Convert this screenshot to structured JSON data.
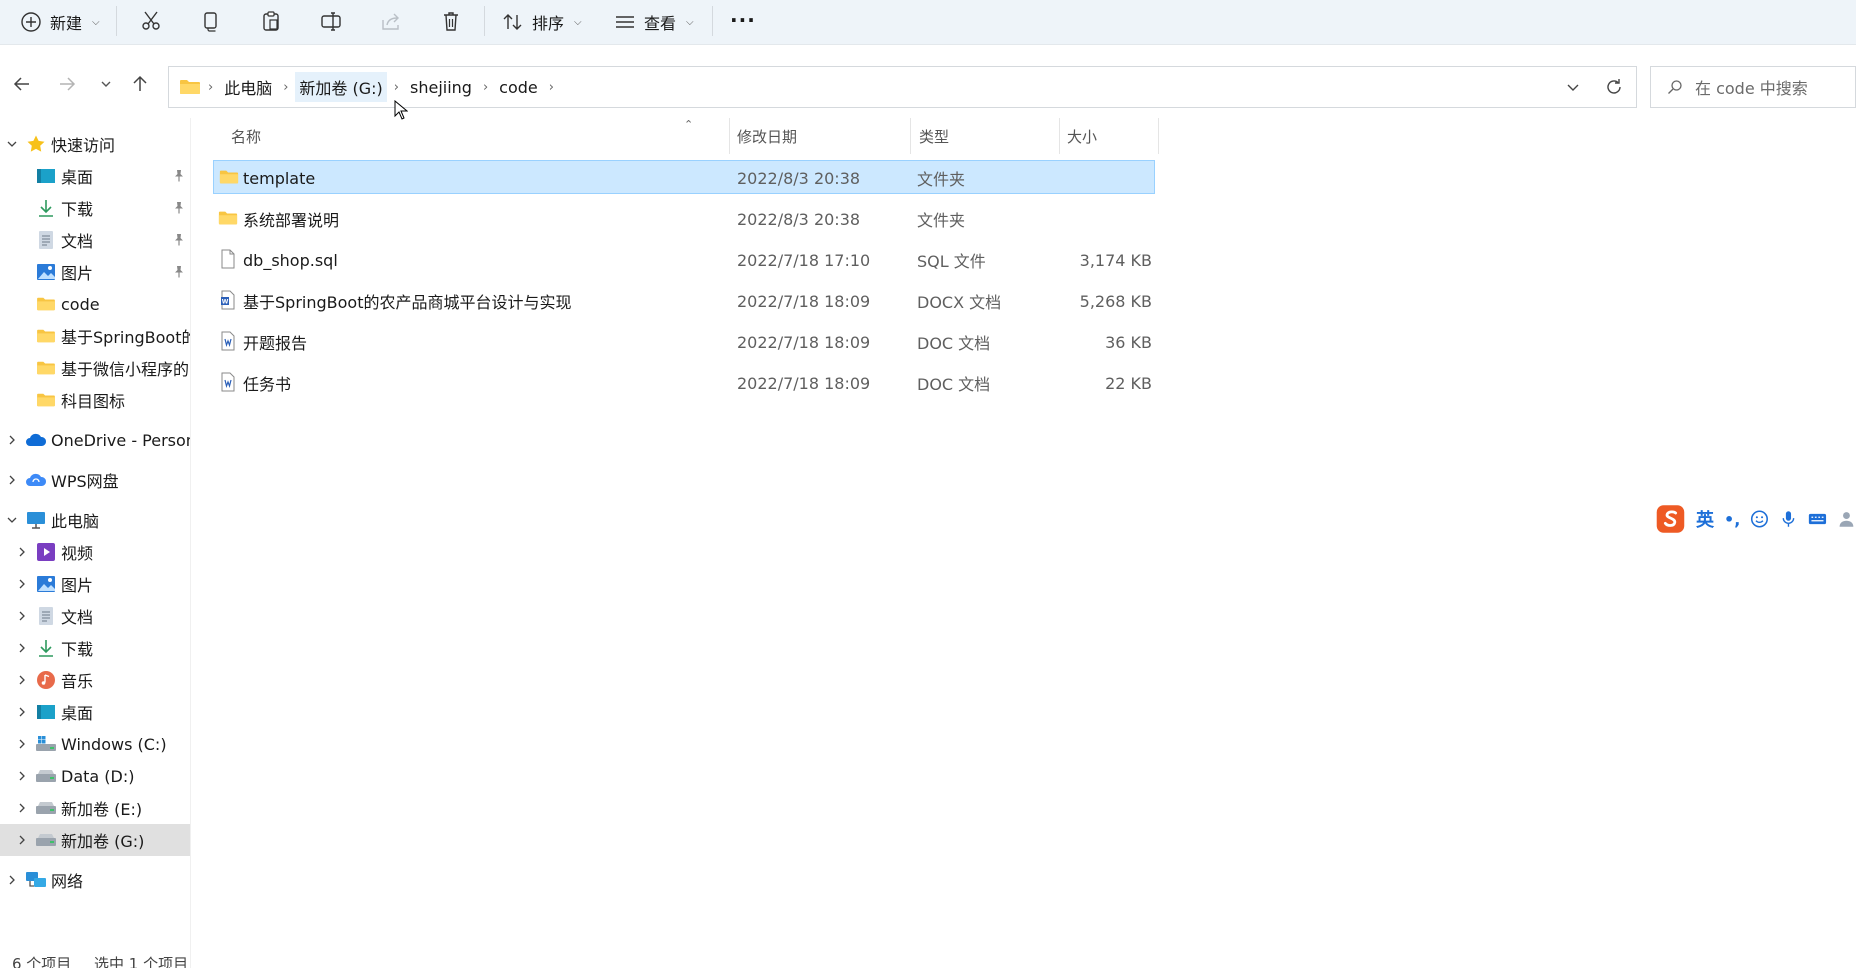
{
  "toolbar": {
    "new_label": "新建",
    "sort_label": "排序",
    "view_label": "查看",
    "more_label": "···"
  },
  "address": {
    "crumbs": [
      "此电脑",
      "新加卷 (G:)",
      "shejiing",
      "code"
    ]
  },
  "search": {
    "placeholder": "在 code 中搜索"
  },
  "sidebar": {
    "quick_access": "快速访问",
    "quick_items": [
      "桌面",
      "下载",
      "文档",
      "图片",
      "code",
      "基于SpringBoot的",
      "基于微信小程序的医",
      "科目图标"
    ],
    "onedrive": "OneDrive - Persona",
    "wps": "WPS网盘",
    "this_pc": "此电脑",
    "pc_items": [
      "视频",
      "图片",
      "文档",
      "下载",
      "音乐",
      "桌面",
      "Windows (C:)",
      "Data (D:)",
      "新加卷 (E:)",
      "新加卷 (G:)"
    ],
    "network": "网络"
  },
  "columns": {
    "name": "名称",
    "modified": "修改日期",
    "type": "类型",
    "size": "大小"
  },
  "files": [
    {
      "name": "template",
      "modified": "2022/8/3 20:38",
      "type": "文件夹",
      "size": "",
      "icon": "folder-icon",
      "selected": true
    },
    {
      "name": "系统部署说明",
      "modified": "2022/8/3 20:38",
      "type": "文件夹",
      "size": "",
      "icon": "folder-icon",
      "selected": false
    },
    {
      "name": "db_shop.sql",
      "modified": "2022/7/18 17:10",
      "type": "SQL 文件",
      "size": "3,174 KB",
      "icon": "file-icon",
      "selected": false
    },
    {
      "name": "基于SpringBoot的农产品商城平台设计与实现",
      "modified": "2022/7/18 18:09",
      "type": "DOCX 文档",
      "size": "5,268 KB",
      "icon": "word-doc-icon",
      "selected": false
    },
    {
      "name": "开题报告",
      "modified": "2022/7/18 18:09",
      "type": "DOC 文档",
      "size": "36 KB",
      "icon": "word-doc-icon",
      "selected": false
    },
    {
      "name": "任务书",
      "modified": "2022/7/18 18:09",
      "type": "DOC 文档",
      "size": "22 KB",
      "icon": "word-doc-icon",
      "selected": false
    }
  ],
  "status": {
    "count": "6 个项目",
    "selected": "选中 1 个项目"
  },
  "ime": {
    "lang": "英",
    "punct": "•,"
  },
  "colors": {
    "accent": "#0067c0",
    "selection_bg": "#cce8ff",
    "selection_border": "#99d1ff",
    "folder": "#f8c542"
  }
}
